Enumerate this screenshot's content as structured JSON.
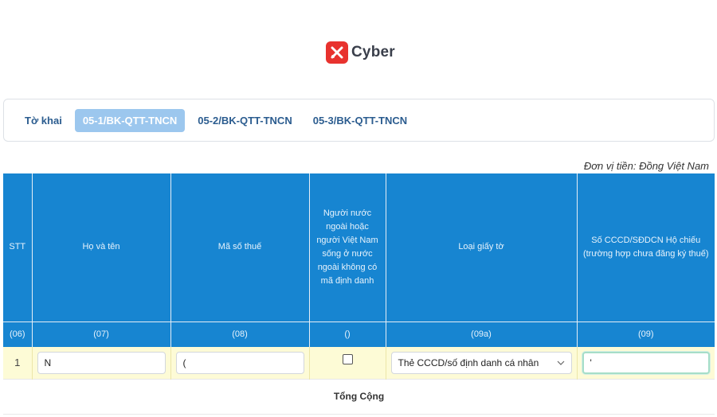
{
  "brand": {
    "name": "Cyber",
    "logo_color": "#e8322e"
  },
  "tabs": [
    {
      "label": "Tờ khai",
      "active": false
    },
    {
      "label": "05-1/BK-QTT-TNCN",
      "active": true
    },
    {
      "label": "05-2/BK-QTT-TNCN",
      "active": false
    },
    {
      "label": "05-3/BK-QTT-TNCN",
      "active": false
    }
  ],
  "unit_note": "Đơn vị tiền: Đồng Việt Nam",
  "table": {
    "header_color": "#1785d1",
    "columns": [
      {
        "label": "STT",
        "code": "(06)"
      },
      {
        "label": "Họ và tên",
        "code": "(07)"
      },
      {
        "label": "Mã số thuế",
        "code": "(08)"
      },
      {
        "label": "Người nước ngoài hoặc người Việt Nam sống ở nước ngoài không có mã định danh",
        "code": "()"
      },
      {
        "label": "Loại giấy tờ",
        "code": "(09a)"
      },
      {
        "label": "Số CCCD/SĐDCN Hộ chiếu (trường hợp chưa đăng ký thuế)",
        "code": "(09)"
      }
    ],
    "row": {
      "stt": "1",
      "name_value": "N",
      "tax_code_value": "(",
      "foreigner_checked": false,
      "doc_type": "Thẻ CCCD/số định danh cá nhân",
      "id_number_value": "'"
    },
    "total_label": "Tổng Cộng"
  }
}
